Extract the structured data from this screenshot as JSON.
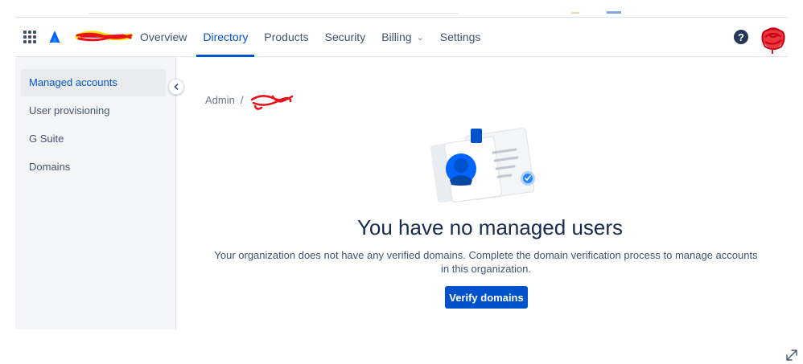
{
  "header": {
    "nav_tabs": [
      {
        "label": "Overview",
        "active": false
      },
      {
        "label": "Directory",
        "active": true
      },
      {
        "label": "Products",
        "active": false
      },
      {
        "label": "Security",
        "active": false
      },
      {
        "label": "Billing",
        "active": false,
        "has_dropdown": true
      },
      {
        "label": "Settings",
        "active": false
      }
    ],
    "help_glyph": "?"
  },
  "sidebar": {
    "items": [
      {
        "label": "Managed accounts",
        "selected": true
      },
      {
        "label": "User provisioning",
        "selected": false
      },
      {
        "label": "G Suite",
        "selected": false
      },
      {
        "label": "Domains",
        "selected": false
      }
    ]
  },
  "breadcrumb": {
    "root": "Admin",
    "separator": "/"
  },
  "empty_state": {
    "title": "You have no managed users",
    "description": "Your organization does not have any verified domains. Complete the domain verification process to manage accounts in this organization.",
    "action_label": "Verify domains"
  },
  "colors": {
    "accent": "#0052cc",
    "sidebar_bg": "#f4f5f7",
    "text_primary": "#172b4d",
    "text_secondary": "#42526e",
    "redaction": "#e8101a"
  },
  "icons": [
    "app-switcher-icon",
    "atlassian-logo-icon",
    "chevron-down-icon",
    "help-icon",
    "chevron-left-icon",
    "expand-icon"
  ]
}
